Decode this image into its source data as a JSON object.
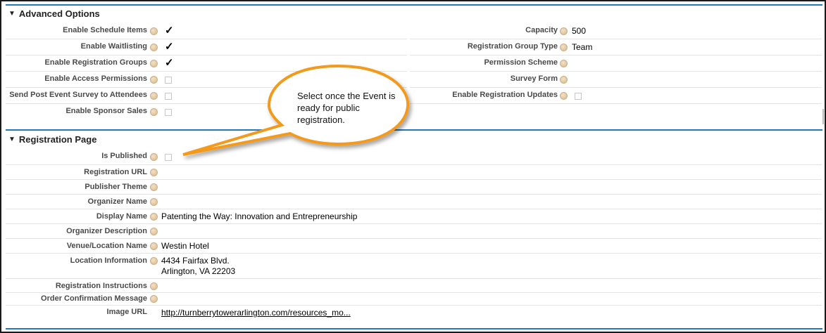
{
  "advanced": {
    "title": "Advanced Options",
    "left": [
      {
        "label": "Enable Schedule Items",
        "checked": true
      },
      {
        "label": "Enable Waitlisting",
        "checked": true
      },
      {
        "label": "Enable Registration Groups",
        "checked": true
      },
      {
        "label": "Enable Access Permissions",
        "checked": false
      },
      {
        "label": "Send Post Event Survey to Attendees",
        "checked": false
      },
      {
        "label": "Enable Sponsor Sales",
        "checked": false
      }
    ],
    "right": [
      {
        "label": "Capacity",
        "value": "500"
      },
      {
        "label": "Registration Group Type",
        "value": "Team"
      },
      {
        "label": "Permission Scheme",
        "value": ""
      },
      {
        "label": "Survey Form",
        "value": ""
      },
      {
        "label": "Enable Registration Updates",
        "checked": false
      }
    ]
  },
  "registration": {
    "title": "Registration Page",
    "is_published": {
      "label": "Is Published",
      "checked": false
    },
    "fields": [
      {
        "label": "Registration URL",
        "value": ""
      },
      {
        "label": "Publisher Theme",
        "value": ""
      },
      {
        "label": "Organizer Name",
        "value": ""
      },
      {
        "label": "Display Name",
        "value": "Patenting the Way: Innovation and Entrepreneurship"
      },
      {
        "label": "Organizer Description",
        "value": ""
      },
      {
        "label": "Venue/Location Name",
        "value": "Westin Hotel"
      },
      {
        "label": "Location Information",
        "line1": "4434 Fairfax Blvd.",
        "line2": "Arlington, VA 22203"
      },
      {
        "label": "Registration Instructions",
        "value": ""
      },
      {
        "label": "Order Confirmation Message",
        "value": ""
      },
      {
        "label": "Image URL",
        "value": "http://turnberrytowerarlington.com/resources_mo..."
      }
    ]
  },
  "callout": {
    "text": "Select once the Event is ready for public registration."
  },
  "colors": {
    "accent": "#1e7ab8",
    "callout_fill": "#ffffff",
    "callout_stroke": "#f39a1e"
  }
}
